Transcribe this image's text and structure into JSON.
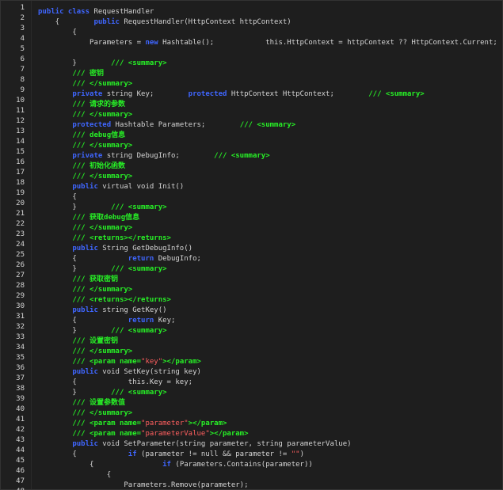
{
  "colors": {
    "background": "#1e1e1e",
    "keyword": "#3f66ff",
    "comment": "#27f026",
    "string": "#ff5f5f",
    "text": "#d4d4d4",
    "line_number": "#d7d7d7"
  },
  "lines": [
    {
      "n": "1",
      "tokens": [
        [
          "kw",
          "public class"
        ],
        [
          "tx",
          " RequestHandler"
        ]
      ]
    },
    {
      "n": "2",
      "tokens": [
        [
          "tx",
          "    {        "
        ],
        [
          "kw",
          "public"
        ],
        [
          "tx",
          " RequestHandler(HttpContext httpContext)"
        ]
      ]
    },
    {
      "n": "3",
      "tokens": [
        [
          "tx",
          "        {"
        ]
      ]
    },
    {
      "n": "4",
      "tokens": [
        [
          "tx",
          "            Parameters = "
        ],
        [
          "kw",
          "new"
        ],
        [
          "tx",
          " Hashtable();            this.HttpContext = httpContext ?? HttpContext.Current;"
        ]
      ]
    },
    {
      "n": "5",
      "tokens": [
        [
          "tx",
          ""
        ]
      ]
    },
    {
      "n": "6",
      "tokens": [
        [
          "tx",
          "        }        "
        ],
        [
          "cm",
          "/// <summary>"
        ]
      ]
    },
    {
      "n": "7",
      "tokens": [
        [
          "cm",
          "        /// 密钥"
        ]
      ]
    },
    {
      "n": "8",
      "tokens": [
        [
          "cm",
          "        /// </summary>"
        ]
      ]
    },
    {
      "n": "9",
      "tokens": [
        [
          "kw",
          "        private"
        ],
        [
          "tx",
          " string Key;        "
        ],
        [
          "kw",
          "protected"
        ],
        [
          "tx",
          " HttpContext HttpContext;        "
        ],
        [
          "cm",
          "/// <summary>"
        ]
      ]
    },
    {
      "n": "10",
      "tokens": [
        [
          "cm",
          "        /// 请求的参数"
        ]
      ]
    },
    {
      "n": "11",
      "tokens": [
        [
          "cm",
          "        /// </summary>"
        ]
      ]
    },
    {
      "n": "12",
      "tokens": [
        [
          "kw",
          "        protected"
        ],
        [
          "tx",
          " Hashtable Parameters;        "
        ],
        [
          "cm",
          "/// <summary>"
        ]
      ]
    },
    {
      "n": "13",
      "tokens": [
        [
          "cm",
          "        /// debug信息"
        ]
      ]
    },
    {
      "n": "14",
      "tokens": [
        [
          "cm",
          "        /// </summary>"
        ]
      ]
    },
    {
      "n": "15",
      "tokens": [
        [
          "kw",
          "        private"
        ],
        [
          "tx",
          " string DebugInfo;        "
        ],
        [
          "cm",
          "/// <summary>"
        ]
      ]
    },
    {
      "n": "16",
      "tokens": [
        [
          "cm",
          "        /// 初始化函数"
        ]
      ]
    },
    {
      "n": "17",
      "tokens": [
        [
          "cm",
          "        /// </summary>"
        ]
      ]
    },
    {
      "n": "18",
      "tokens": [
        [
          "kw",
          "        public"
        ],
        [
          "tx",
          " virtual void Init()"
        ]
      ]
    },
    {
      "n": "19",
      "tokens": [
        [
          "tx",
          "        {"
        ]
      ]
    },
    {
      "n": "20",
      "tokens": [
        [
          "tx",
          "        }        "
        ],
        [
          "cm",
          "/// <summary>"
        ]
      ]
    },
    {
      "n": "21",
      "tokens": [
        [
          "cm",
          "        /// 获取debug信息"
        ]
      ]
    },
    {
      "n": "22",
      "tokens": [
        [
          "cm",
          "        /// </summary>"
        ]
      ]
    },
    {
      "n": "23",
      "tokens": [
        [
          "cm",
          "        /// <returns></returns>"
        ]
      ]
    },
    {
      "n": "24",
      "tokens": [
        [
          "kw",
          "        public"
        ],
        [
          "tx",
          " String GetDebugInfo()"
        ]
      ]
    },
    {
      "n": "25",
      "tokens": [
        [
          "tx",
          "        {            "
        ],
        [
          "kw",
          "return"
        ],
        [
          "tx",
          " DebugInfo;"
        ]
      ]
    },
    {
      "n": "26",
      "tokens": [
        [
          "tx",
          "        }        "
        ],
        [
          "cm",
          "/// <summary>"
        ]
      ]
    },
    {
      "n": "27",
      "tokens": [
        [
          "cm",
          "        /// 获取密钥"
        ]
      ]
    },
    {
      "n": "28",
      "tokens": [
        [
          "cm",
          "        /// </summary>"
        ]
      ]
    },
    {
      "n": "29",
      "tokens": [
        [
          "cm",
          "        /// <returns></returns>"
        ]
      ]
    },
    {
      "n": "30",
      "tokens": [
        [
          "kw",
          "        public"
        ],
        [
          "tx",
          " string GetKey()"
        ]
      ]
    },
    {
      "n": "31",
      "tokens": [
        [
          "tx",
          "        {            "
        ],
        [
          "kw",
          "return"
        ],
        [
          "tx",
          " Key;"
        ]
      ]
    },
    {
      "n": "32",
      "tokens": [
        [
          "tx",
          "        }        "
        ],
        [
          "cm",
          "/// <summary>"
        ]
      ]
    },
    {
      "n": "33",
      "tokens": [
        [
          "cm",
          "        /// 设置密钥"
        ]
      ]
    },
    {
      "n": "34",
      "tokens": [
        [
          "cm",
          "        /// </summary>"
        ]
      ]
    },
    {
      "n": "35",
      "tokens": [
        [
          "cm",
          "        /// <param name="
        ],
        [
          "st",
          "\"key\""
        ],
        [
          "cm",
          "></param>"
        ]
      ]
    },
    {
      "n": "36",
      "tokens": [
        [
          "kw",
          "        public"
        ],
        [
          "tx",
          " void SetKey(string key)"
        ]
      ]
    },
    {
      "n": "37",
      "tokens": [
        [
          "tx",
          "        {            this.Key = key;"
        ]
      ]
    },
    {
      "n": "38",
      "tokens": [
        [
          "tx",
          "        }        "
        ],
        [
          "cm",
          "/// <summary>"
        ]
      ]
    },
    {
      "n": "39",
      "tokens": [
        [
          "cm",
          "        /// 设置参数值"
        ]
      ]
    },
    {
      "n": "40",
      "tokens": [
        [
          "cm",
          "        /// </summary>"
        ]
      ]
    },
    {
      "n": "41",
      "tokens": [
        [
          "cm",
          "        /// <param name="
        ],
        [
          "st",
          "\"parameter\""
        ],
        [
          "cm",
          "></param>"
        ]
      ]
    },
    {
      "n": "42",
      "tokens": [
        [
          "cm",
          "        /// <param name="
        ],
        [
          "st",
          "\"parameterValue\""
        ],
        [
          "cm",
          "></param>"
        ]
      ]
    },
    {
      "n": "43",
      "tokens": [
        [
          "kw",
          "        public"
        ],
        [
          "tx",
          " void SetParameter(string parameter, string parameterValue)"
        ]
      ]
    },
    {
      "n": "44",
      "tokens": [
        [
          "tx",
          "        {            "
        ],
        [
          "kw",
          "if"
        ],
        [
          "tx",
          " (parameter != null && parameter != "
        ],
        [
          "st",
          "\"\""
        ],
        [
          "tx",
          ")"
        ]
      ]
    },
    {
      "n": "45",
      "tokens": [
        [
          "tx",
          "            {                "
        ],
        [
          "kw",
          "if"
        ],
        [
          "tx",
          " (Parameters.Contains(parameter))"
        ]
      ]
    },
    {
      "n": "46",
      "tokens": [
        [
          "tx",
          "                {"
        ]
      ]
    },
    {
      "n": "47",
      "tokens": [
        [
          "tx",
          "                    Parameters.Remove(parameter);"
        ]
      ]
    },
    {
      "n": "48",
      "tokens": [
        [
          "tx",
          "                }"
        ]
      ]
    }
  ]
}
